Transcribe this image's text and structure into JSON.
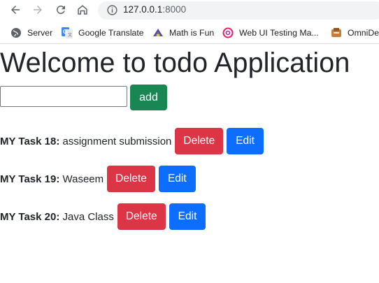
{
  "browser": {
    "url_host": "127.0.0.1",
    "url_port": ":8000",
    "bookmarks": [
      {
        "label": "Server",
        "icon": "globe-icon"
      },
      {
        "label": "Google Translate",
        "icon": "google-translate-icon"
      },
      {
        "label": "Math is Fun",
        "icon": "math-is-fun-icon"
      },
      {
        "label": "Web UI Testing Ma...",
        "icon": "web-ui-testing-icon"
      },
      {
        "label": "OmniDe",
        "icon": "omnidev-icon"
      }
    ]
  },
  "page": {
    "title": "Welcome to todo Application",
    "input_value": "",
    "add_label": "add",
    "tasks": [
      {
        "prefix": "MY Task 18:",
        "text": " assignment submission",
        "delete_label": "Delete",
        "edit_label": "Edit"
      },
      {
        "prefix": "MY Task 19:",
        "text": " Waseem",
        "delete_label": "Delete",
        "edit_label": "Edit"
      },
      {
        "prefix": "MY Task 20:",
        "text": " Java Class",
        "delete_label": "Delete",
        "edit_label": "Edit"
      }
    ]
  },
  "colors": {
    "add": "#198754",
    "delete": "#dc3545",
    "edit": "#0d6efd"
  }
}
